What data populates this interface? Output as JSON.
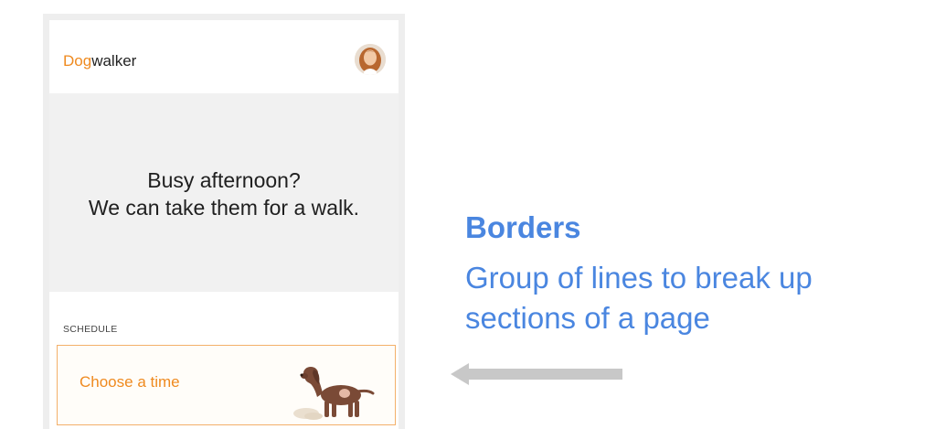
{
  "app": {
    "brand_prefix": "Dog",
    "brand_suffix": "walker"
  },
  "hero": {
    "line1": "Busy afternoon?",
    "line2": "We can take them for a walk."
  },
  "schedule": {
    "section_label": "SCHEDULE",
    "card_label": "Choose a time"
  },
  "annotation": {
    "title": "Borders",
    "line1": "Group of lines to break up",
    "line2": "sections of a page"
  },
  "colors": {
    "brand_orange": "#ef8a1f",
    "card_border": "#f3b06a",
    "annotation_blue": "#4a86e0",
    "hero_bg": "#f1f1f1",
    "arrow_gray": "#c8c8c8"
  },
  "icons": {
    "avatar": "profile-photo",
    "card_illustration": "dog-illustration",
    "pointer": "left-arrow-icon"
  }
}
